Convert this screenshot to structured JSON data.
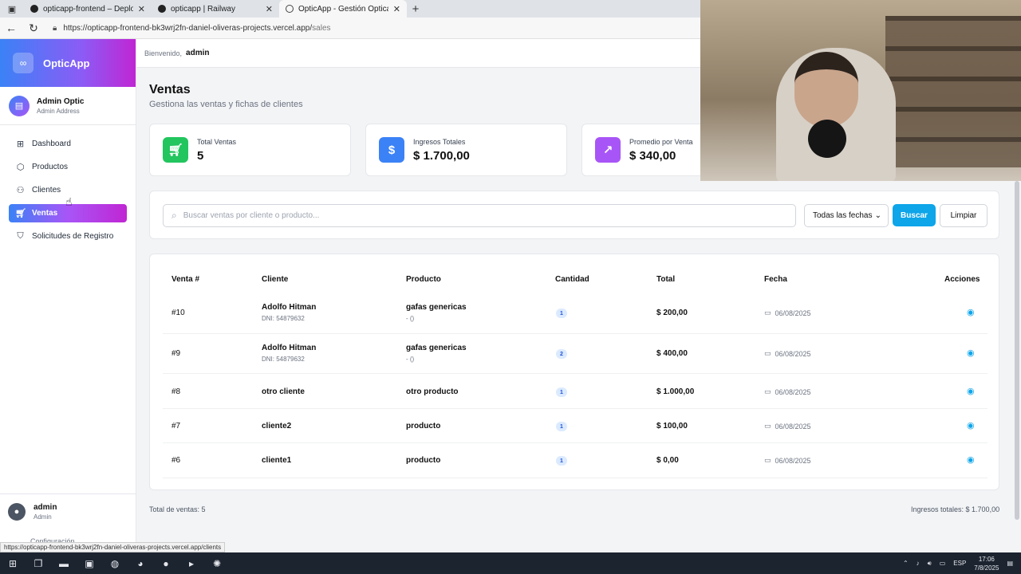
{
  "browser": {
    "tabs": [
      {
        "title": "opticapp-frontend – Deployment"
      },
      {
        "title": "opticapp | Railway"
      },
      {
        "title": "OpticApp - Gestión Óptica"
      }
    ],
    "url_host": "https://opticapp-frontend-bk3wrj2fn-daniel-oliveras-projects.vercel.app/",
    "url_path": "sales",
    "status_url": "https://opticapp-frontend-bk3wrj2fn-daniel-oliveras-projects.vercel.app/clients"
  },
  "sidebar": {
    "brand": "OpticApp",
    "user_name": "Admin Optic",
    "user_sub": "Admin Address",
    "items": [
      {
        "label": "Dashboard",
        "icon": "grid-icon"
      },
      {
        "label": "Productos",
        "icon": "box-icon"
      },
      {
        "label": "Clientes",
        "icon": "users-icon"
      },
      {
        "label": "Ventas",
        "icon": "cart-icon"
      },
      {
        "label": "Solicitudes de Registro",
        "icon": "shield-icon"
      }
    ],
    "footer_name": "admin",
    "footer_role": "Admin",
    "config_label": "Configuración"
  },
  "topbar": {
    "welcome": "Bienvenido,",
    "user": "admin"
  },
  "page": {
    "title": "Ventas",
    "subtitle": "Gestiona las ventas y fichas de clientes"
  },
  "stats": [
    {
      "label": "Total Ventas",
      "value": "5",
      "color": "#22c55e"
    },
    {
      "label": "Ingresos Totales",
      "value": "$ 1.700,00",
      "color": "#3b82f6"
    },
    {
      "label": "Promedio por Venta",
      "value": "$ 340,00",
      "color": "#a855f7"
    }
  ],
  "filters": {
    "search_placeholder": "Buscar ventas por cliente o producto...",
    "date_select": "Todas las fechas",
    "buscar": "Buscar",
    "limpiar": "Limpiar"
  },
  "table": {
    "headers": [
      "Venta #",
      "Cliente",
      "Producto",
      "Cantidad",
      "Total",
      "Fecha",
      "Acciones"
    ],
    "rows": [
      {
        "id": "#10",
        "cliente": "Adolfo Hitman",
        "dni": "DNI: 54879632",
        "producto": "gafas genericas",
        "producto_sub": "- ()",
        "cantidad": "1",
        "total": "$ 200,00",
        "fecha": "06/08/2025"
      },
      {
        "id": "#9",
        "cliente": "Adolfo Hitman",
        "dni": "DNI: 54879632",
        "producto": "gafas genericas",
        "producto_sub": "- ()",
        "cantidad": "2",
        "total": "$ 400,00",
        "fecha": "06/08/2025"
      },
      {
        "id": "#8",
        "cliente": "otro cliente",
        "dni": "",
        "producto": "otro producto",
        "producto_sub": "",
        "cantidad": "1",
        "total": "$ 1.000,00",
        "fecha": "06/08/2025"
      },
      {
        "id": "#7",
        "cliente": "cliente2",
        "dni": "",
        "producto": "producto",
        "producto_sub": "",
        "cantidad": "1",
        "total": "$ 100,00",
        "fecha": "06/08/2025"
      },
      {
        "id": "#6",
        "cliente": "cliente1",
        "dni": "",
        "producto": "producto",
        "producto_sub": "",
        "cantidad": "1",
        "total": "$ 0,00",
        "fecha": "06/08/2025"
      }
    ]
  },
  "footer": {
    "total_ventas": "Total de ventas: 5",
    "ingresos": "Ingresos totales: $ 1.700,00"
  },
  "taskbar": {
    "lang": "ESP",
    "time": "17:06",
    "date": "7/8/2025"
  }
}
